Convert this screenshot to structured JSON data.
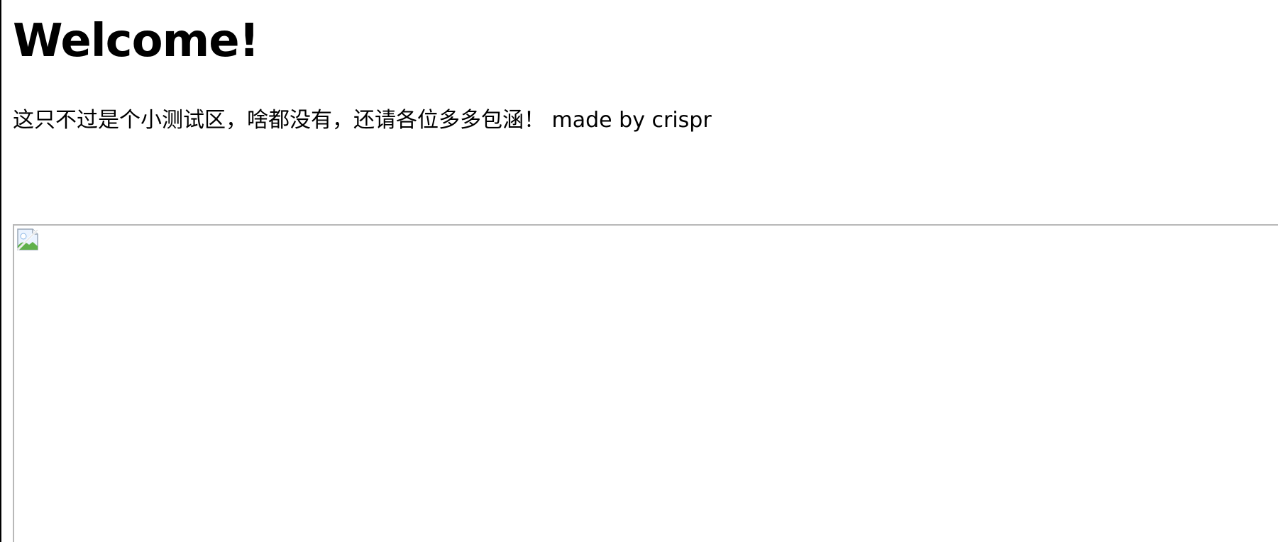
{
  "page": {
    "title": "Welcome!",
    "intro": "这只不过是个小测试区，啥都没有，还请各位多多包涵！ made by crispr"
  },
  "image": {
    "icon": "broken-image-icon",
    "state": "failed to load"
  }
}
